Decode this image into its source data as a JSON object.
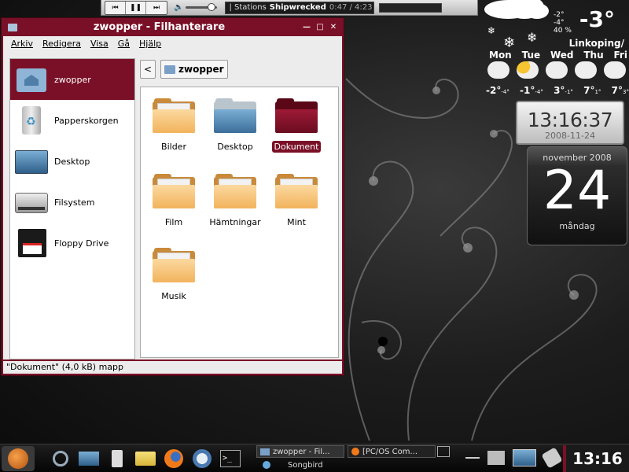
{
  "player": {
    "station": "| Stations",
    "track": "Shipwrecked",
    "time": "0:47 / 4:23",
    "prev_icon": "prev-icon",
    "pause_icon": "pause-icon",
    "next_icon": "next-icon"
  },
  "weather": {
    "current_temp": "-3°",
    "hi": "-2°",
    "lo": "-4°",
    "humidity": "40 %",
    "city": "Linkoping/",
    "days": [
      "Mon",
      "Tue",
      "Wed",
      "Thu",
      "Fri"
    ],
    "temps": [
      {
        "hi": "-2°",
        "lo": "-4°"
      },
      {
        "hi": "-1°",
        "lo": "-4°"
      },
      {
        "hi": "3°",
        "lo": "-1°"
      },
      {
        "hi": "7°",
        "lo": "1°"
      },
      {
        "hi": "7°",
        "lo": "3°"
      }
    ]
  },
  "clock": {
    "time": "13:16:37",
    "date": "2008-11-24"
  },
  "calendar": {
    "month": "november 2008",
    "day": "24",
    "weekday": "måndag"
  },
  "window": {
    "title": "zwopper - Filhanterare",
    "menu": [
      "Arkiv",
      "Redigera",
      "Visa",
      "Gå",
      "Hjälp"
    ],
    "sidebar": [
      {
        "label": "zwopper",
        "icon": "home-folder-icon"
      },
      {
        "label": "Papperskorgen",
        "icon": "trash-icon"
      },
      {
        "label": "Desktop",
        "icon": "desktop-icon"
      },
      {
        "label": "Filsystem",
        "icon": "harddisk-icon"
      },
      {
        "label": "Floppy Drive",
        "icon": "floppy-icon"
      }
    ],
    "back_label": "<",
    "path": "zwopper",
    "files": [
      "Bilder",
      "Desktop",
      "Dokument",
      "Film",
      "Hämtningar",
      "Mint",
      "Musik"
    ],
    "selected": "Dokument",
    "status": "\"Dokument\" (4,0 kB) mapp"
  },
  "taskbar": {
    "task1": "zwopper - Fil...",
    "task2": "[PC/OS Com...",
    "task3": "Songbird",
    "clock": "13:16"
  },
  "colors": {
    "accent": "#7a1027"
  }
}
